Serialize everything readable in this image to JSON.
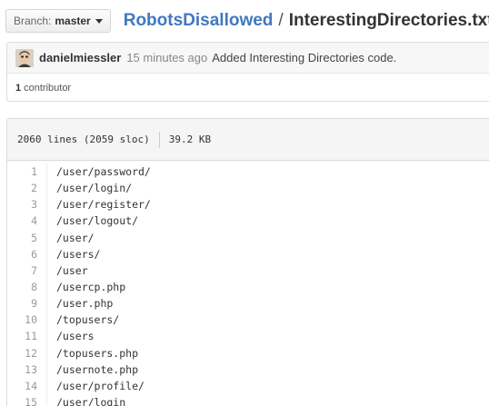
{
  "branch": {
    "prefix": "Branch:",
    "name": "master"
  },
  "breadcrumb": {
    "repo": "RobotsDisallowed",
    "separator": "/",
    "file": "InterestingDirectories.txt"
  },
  "commit": {
    "author": "danielmiessler",
    "time": "15 minutes ago",
    "message": "Added Interesting Directories code.",
    "contributors_count": "1",
    "contributors_label": "contributor"
  },
  "file_info": {
    "lines": "2060 lines (2059 sloc)",
    "size": "39.2 KB"
  },
  "code_lines": [
    {
      "n": "1",
      "text": "/user/password/"
    },
    {
      "n": "2",
      "text": "/user/login/"
    },
    {
      "n": "3",
      "text": "/user/register/"
    },
    {
      "n": "4",
      "text": "/user/logout/"
    },
    {
      "n": "5",
      "text": "/user/"
    },
    {
      "n": "6",
      "text": "/users/"
    },
    {
      "n": "7",
      "text": "/user"
    },
    {
      "n": "8",
      "text": "/usercp.php"
    },
    {
      "n": "9",
      "text": "/user.php"
    },
    {
      "n": "10",
      "text": "/topusers/"
    },
    {
      "n": "11",
      "text": "/users"
    },
    {
      "n": "12",
      "text": "/topusers.php"
    },
    {
      "n": "13",
      "text": "/usernote.php"
    },
    {
      "n": "14",
      "text": "/user/profile/"
    },
    {
      "n": "15",
      "text": "/user/login"
    }
  ],
  "colors": {
    "link": "#4078c0",
    "header_bg": "#f5f5f5",
    "line_number": "#999999"
  },
  "icons": {
    "branch_caret": "caret-down-icon",
    "avatar": "user-avatar"
  }
}
